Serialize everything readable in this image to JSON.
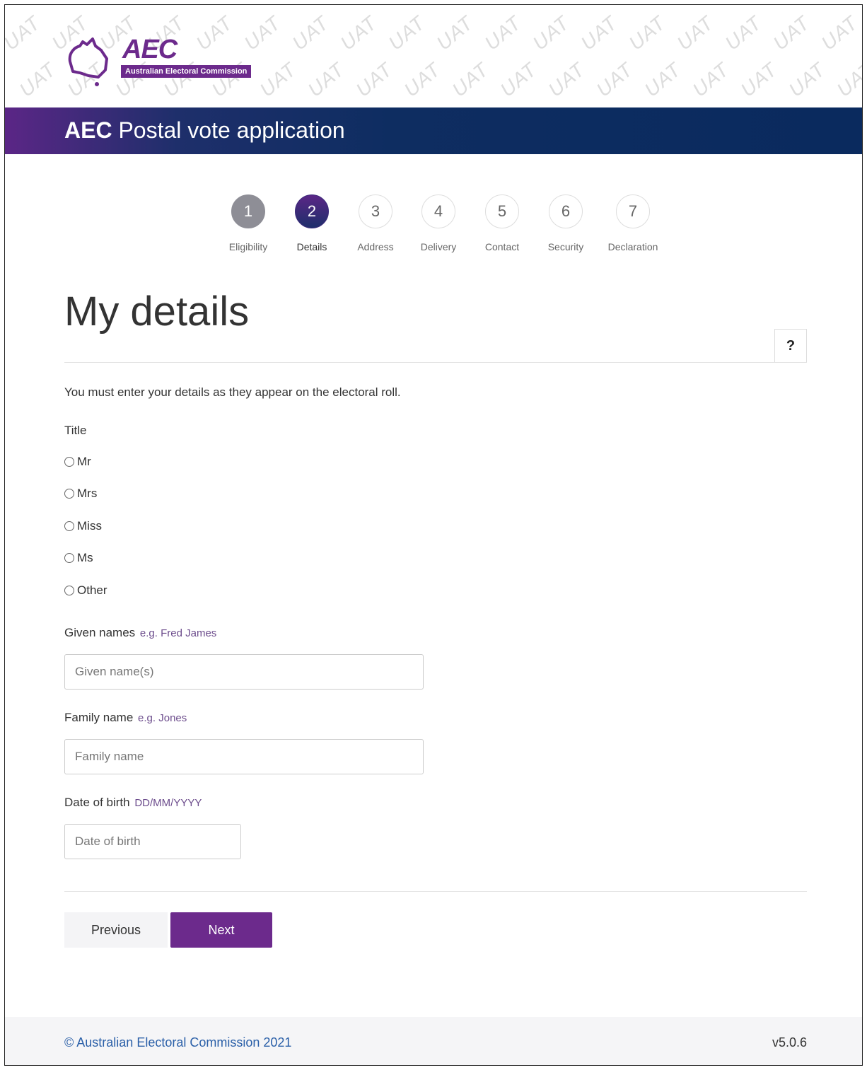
{
  "header": {
    "logo_text": "AEC",
    "logo_subtitle": "Australian Electoral Commission",
    "watermark": "UAT",
    "app_title_bold": "AEC",
    "app_title": "Postal vote application"
  },
  "stepper": {
    "steps": [
      {
        "number": "1",
        "label": "Eligibility",
        "state": "done"
      },
      {
        "number": "2",
        "label": "Details",
        "state": "active"
      },
      {
        "number": "3",
        "label": "Address",
        "state": "todo"
      },
      {
        "number": "4",
        "label": "Delivery",
        "state": "todo"
      },
      {
        "number": "5",
        "label": "Contact",
        "state": "todo"
      },
      {
        "number": "6",
        "label": "Security",
        "state": "todo"
      },
      {
        "number": "7",
        "label": "Declaration",
        "state": "todo"
      }
    ]
  },
  "main": {
    "page_title": "My details",
    "help_label": "?",
    "intro": "You must enter your details as they appear on the electoral roll.",
    "title_label": "Title",
    "title_options": [
      "Mr",
      "Mrs",
      "Miss",
      "Ms",
      "Other"
    ],
    "given_names": {
      "label": "Given names",
      "hint": "e.g. Fred James",
      "placeholder": "Given name(s)",
      "value": ""
    },
    "family_name": {
      "label": "Family name",
      "hint": "e.g. Jones",
      "placeholder": "Family name",
      "value": ""
    },
    "dob": {
      "label": "Date of birth",
      "hint": "DD/MM/YYYY",
      "placeholder": "Date of birth",
      "value": ""
    },
    "previous_label": "Previous",
    "next_label": "Next"
  },
  "footer": {
    "copyright": "© Australian Electoral Commission 2021",
    "version": "v5.0.6"
  },
  "colors": {
    "brand_purple": "#6c2a8c",
    "brand_navy": "#0a2a5e",
    "link_blue": "#2a5fa8"
  }
}
